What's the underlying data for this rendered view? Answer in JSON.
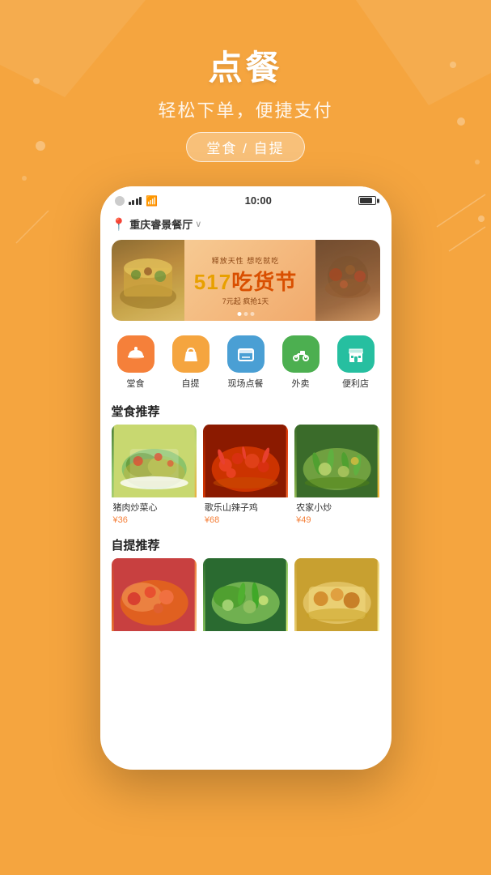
{
  "background": {
    "color": "#F5A53F"
  },
  "header": {
    "title": "点餐",
    "subtitle": "轻松下单，便捷支付",
    "badge": "堂食 / 自提"
  },
  "phone": {
    "statusBar": {
      "time": "10:00"
    },
    "location": {
      "name": "重庆睿景餐厅",
      "arrow": "∨"
    },
    "banner": {
      "small_text": "释放天性 想吃就吃",
      "main_text": "517吃货节",
      "sub_text": "7元起 疯抢1天",
      "dots": [
        true,
        false,
        false
      ]
    },
    "categories": [
      {
        "id": "tangshi",
        "label": "堂食",
        "icon": "🍽",
        "color": "orange"
      },
      {
        "id": "ziti",
        "label": "自提",
        "icon": "🛍",
        "color": "amber"
      },
      {
        "id": "xianchang",
        "label": "现场点餐",
        "icon": "🍱",
        "color": "blue"
      },
      {
        "id": "waimai",
        "label": "外卖",
        "icon": "🛵",
        "color": "green"
      },
      {
        "id": "bianlidian",
        "label": "便利店",
        "icon": "🏪",
        "color": "teal"
      }
    ],
    "sections": [
      {
        "title": "堂食推荐",
        "items": [
          {
            "name": "猪肉炒菜心",
            "price": "¥36",
            "imageClass": "food-image-1"
          },
          {
            "name": "歌乐山辣子鸡",
            "price": "¥68",
            "imageClass": "food-image-2"
          },
          {
            "name": "农家小炒",
            "price": "¥49",
            "imageClass": "food-image-3"
          }
        ]
      },
      {
        "title": "自提推荐",
        "items": [
          {
            "name": "",
            "price": "",
            "imageClass": "food-image-4"
          },
          {
            "name": "",
            "price": "",
            "imageClass": "food-image-5"
          },
          {
            "name": "",
            "price": "",
            "imageClass": "food-image-6"
          }
        ]
      }
    ]
  }
}
